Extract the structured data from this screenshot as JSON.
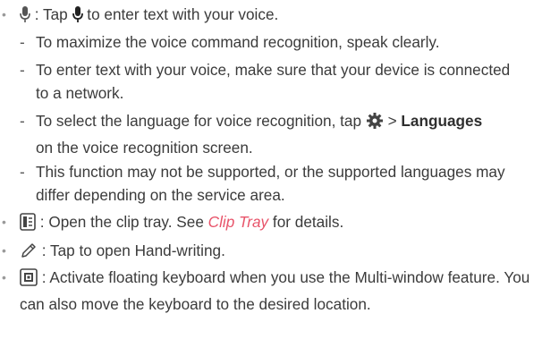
{
  "colors": {
    "text": "#3b3b3b",
    "link": "#e8546a",
    "bullet": "#9a9a9a"
  },
  "voice": {
    "icon": "microphone-icon",
    "sep": " : Tap ",
    "text": " to enter text with your voice.",
    "notes": [
      "To maximize the voice command recognition, speak clearly.",
      "To enter text with your voice, make sure that your device is connected to a network."
    ],
    "lang_note": {
      "pre": "To select the language for voice recognition, tap ",
      "gear_icon": "gear-icon",
      "arrow": " > ",
      "bold": "Languages",
      "post": "on the voice recognition screen."
    },
    "support_note": "This function may not be supported, or the supported languages may differ depending on the service area."
  },
  "clip": {
    "icon": "clip-tray-icon",
    "pre": " : Open the clip tray. See ",
    "link": "Clip Tray",
    "post": " for details."
  },
  "hand": {
    "icon": "pen-icon",
    "text": " : Tap to open Hand-writing."
  },
  "floating": {
    "icon": "floating-keyboard-icon",
    "text": " : Activate floating keyboard when you use the Multi-window feature. You can also move the keyboard to the desired location."
  }
}
